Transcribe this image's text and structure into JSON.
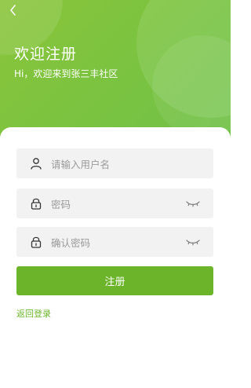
{
  "header": {
    "title": "欢迎注册",
    "subtitle": "Hi，欢迎来到张三丰社区",
    "back_icon": "chevron-left-icon"
  },
  "form": {
    "username": {
      "placeholder": "请输入用户名",
      "icon": "user-icon"
    },
    "password": {
      "placeholder": "密码",
      "icon": "lock-icon",
      "toggle_icon": "eye-closed-icon"
    },
    "confirm_password": {
      "placeholder": "确认密码",
      "icon": "lock-icon",
      "toggle_icon": "eye-closed-icon"
    },
    "submit_label": "注册",
    "back_to_login_label": "返回登录"
  },
  "colors": {
    "brand_green": "#6cb52b",
    "header_gradient_start": "#8ac43a",
    "header_gradient_end": "#6fc24a",
    "field_background": "#f2f2f2",
    "placeholder_text": "#9a9a9a"
  }
}
